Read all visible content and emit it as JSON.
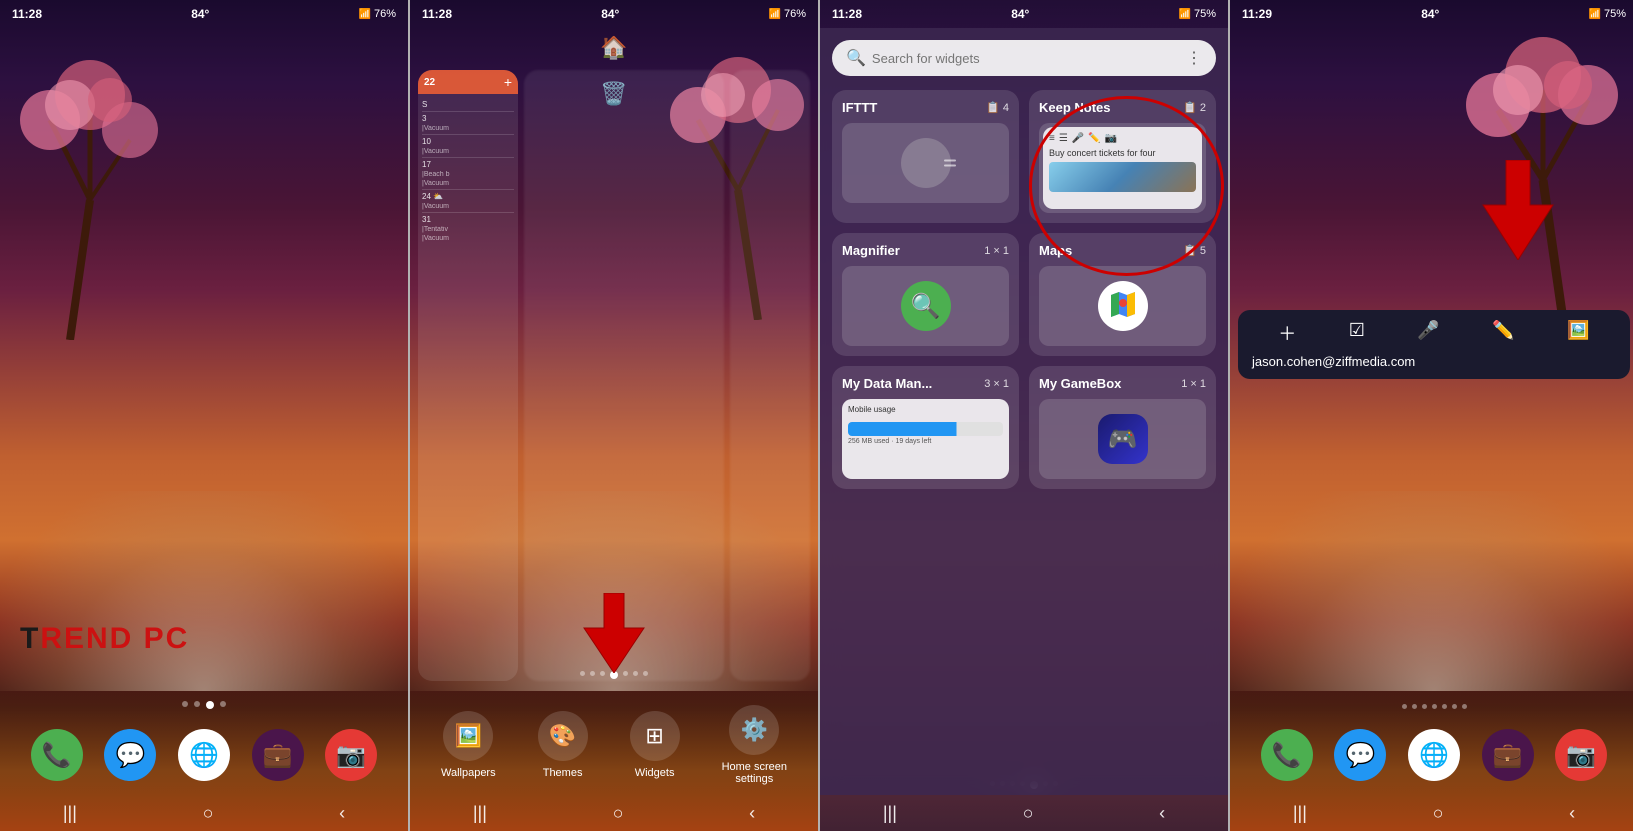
{
  "panels": [
    {
      "id": "panel1",
      "status": {
        "time": "11:28",
        "temp": "84°",
        "battery": "76%",
        "signal": "📶"
      },
      "brand": "TREND PC",
      "dock": [
        "📞",
        "💬",
        "🌐",
        "💼",
        "📷"
      ],
      "dots": [
        false,
        false,
        true,
        false
      ],
      "nav": [
        "|||",
        "○",
        "<"
      ]
    },
    {
      "id": "panel2",
      "status": {
        "time": "11:28",
        "temp": "84°",
        "battery": "76%"
      },
      "menu": [
        {
          "icon": "🖼️",
          "label": "Wallpapers"
        },
        {
          "icon": "🎨",
          "label": "Themes"
        },
        {
          "icon": "⊞",
          "label": "Widgets"
        },
        {
          "icon": "⚙️",
          "label": "Home screen\nsettings"
        }
      ],
      "arrow_direction": "down",
      "dots": [
        false,
        false,
        false,
        true,
        false,
        false,
        false
      ],
      "nav": [
        "|||",
        "○",
        "<"
      ]
    },
    {
      "id": "panel3",
      "status": {
        "time": "11:28",
        "temp": "84°",
        "battery": "75%"
      },
      "search_placeholder": "Search for widgets",
      "widgets": [
        {
          "name": "IFTTT",
          "count": "4",
          "icon": "📱"
        },
        {
          "name": "Keep Notes",
          "count": "2",
          "is_highlighted": true
        },
        {
          "name": "Magnifier",
          "size": "1 × 1",
          "icon": "🔍"
        },
        {
          "name": "Maps",
          "count": "5",
          "icon": "🗺️"
        },
        {
          "name": "My Data Man...",
          "size": "3 × 1"
        },
        {
          "name": "My GameBox",
          "size": "1 × 1",
          "icon": "🎮"
        }
      ],
      "dots": [
        false,
        false,
        false,
        false,
        true,
        false,
        false
      ],
      "nav": [
        "|||",
        "○",
        "<"
      ]
    },
    {
      "id": "panel4",
      "status": {
        "time": "11:29",
        "temp": "84°",
        "battery": "75%"
      },
      "arrow_direction": "down",
      "note_tools": [
        "+",
        "☑",
        "🎤",
        "✏️",
        "🖼️"
      ],
      "note_email": "jason.cohen@ziffmedia.com",
      "dots": [
        false,
        false,
        false,
        false,
        false,
        false,
        false
      ],
      "dock": [
        "📞",
        "💬",
        "🌐",
        "💼",
        "📷"
      ],
      "nav": [
        "|||",
        "○",
        "<"
      ]
    }
  ]
}
